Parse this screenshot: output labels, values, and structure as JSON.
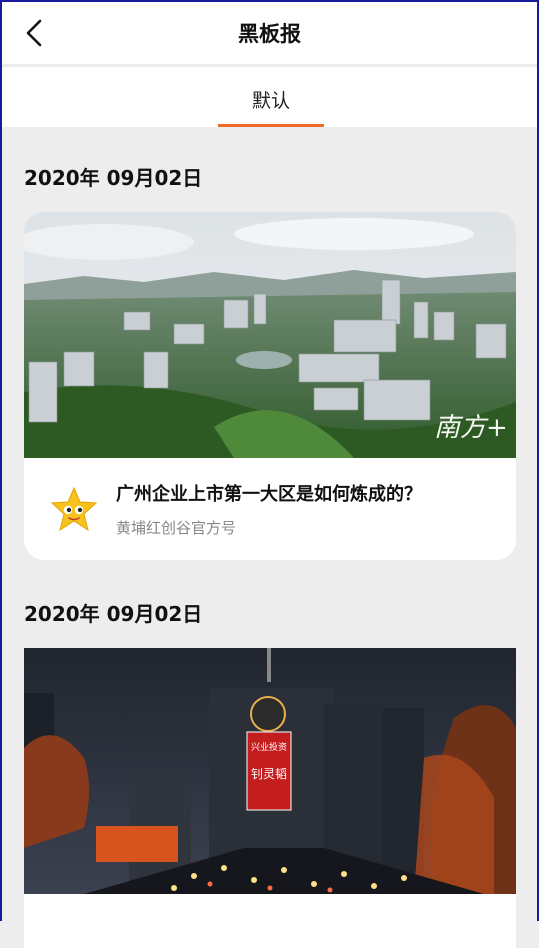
{
  "header": {
    "title": "黑板报",
    "back_icon": "chevron-left-icon"
  },
  "tabs": [
    {
      "label": "默认",
      "active": true,
      "accent": "#f06a2a"
    }
  ],
  "feed": [
    {
      "date": "2020年  09月02日",
      "title": "广州企业上市第一大区是如何炼成的？",
      "source": "黄埔红创谷官方号",
      "watermark": "南方+",
      "image": "aerial-city-photo"
    },
    {
      "date": "2020年  09月02日",
      "image": "night-city-photo",
      "billboard": [
        "兴业投资",
        "钊灵韬"
      ]
    }
  ]
}
